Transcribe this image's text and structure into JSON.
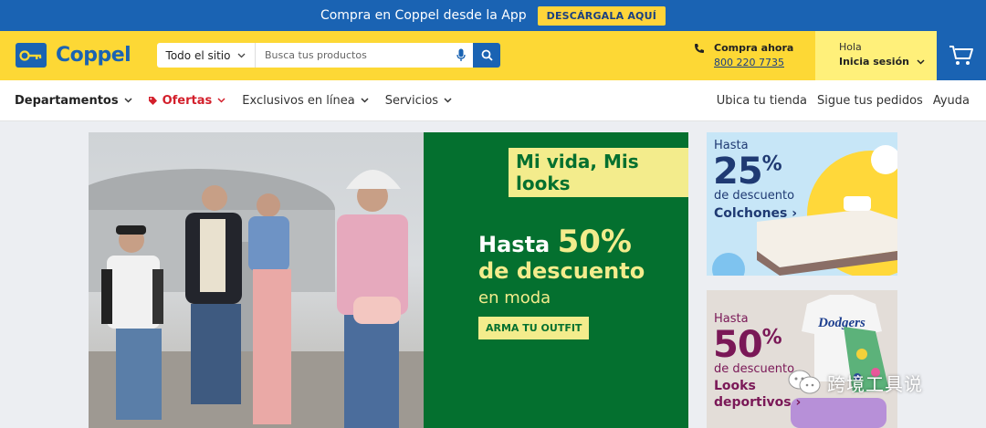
{
  "promo": {
    "text": "Compra en Coppel desde la App",
    "button": "DESCÁRGALA AQUÍ"
  },
  "header": {
    "logo_text": "Coppel",
    "search": {
      "scope": "Todo el sitio",
      "placeholder": "Busca tus productos"
    },
    "call": {
      "title": "Compra ahora",
      "phone": "800 220 7735"
    },
    "account": {
      "greeting": "Hola",
      "login": "Inicia sesión"
    }
  },
  "nav": {
    "left": [
      {
        "label": "Departamentos"
      },
      {
        "label": "Ofertas"
      },
      {
        "label": "Exclusivos en línea"
      },
      {
        "label": "Servicios"
      }
    ],
    "right": [
      {
        "label": "Ubica tu tienda"
      },
      {
        "label": "Sigue tus pedidos"
      },
      {
        "label": "Ayuda"
      }
    ]
  },
  "hero": {
    "tag": "Mi vida, Mis looks",
    "line1_prefix": "Hasta",
    "line1_pct": "50%",
    "line2": "de descuento",
    "line3": "en moda",
    "cta": "ARMA TU OUTFIT"
  },
  "side_promos": [
    {
      "hasta": "Hasta",
      "pct": "25",
      "pct_sign": "%",
      "desc": "de descuento",
      "cat1": "Colchones ›",
      "cat2": ""
    },
    {
      "hasta": "Hasta",
      "pct": "50",
      "pct_sign": "%",
      "desc": "de descuento",
      "cat1": "Looks",
      "cat2": "deportivos ›",
      "shirt_text": "Dodgers"
    }
  ],
  "watermark": "跨境工具说",
  "colors": {
    "brand_blue": "#1a63b3",
    "brand_yellow": "#fdd835",
    "hero_green": "#04702f",
    "offer_red": "#d31f2b"
  }
}
